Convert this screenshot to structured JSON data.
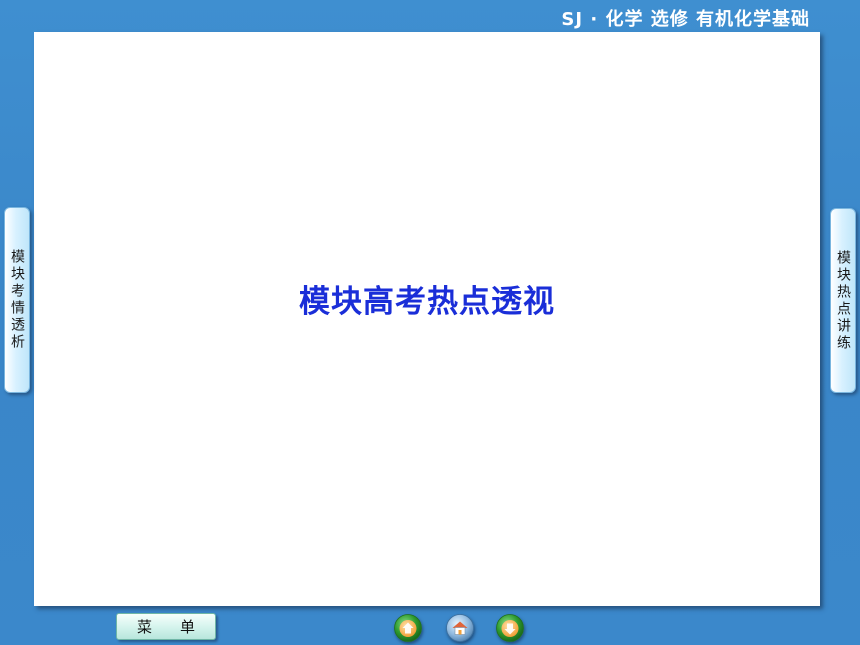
{
  "header": {
    "title": "SJ · 化学  选修  有机化学基础"
  },
  "slide": {
    "heading": "模块高考热点透视"
  },
  "side_tabs": {
    "left_label": "模块考情透析",
    "right_label": "模块热点讲练"
  },
  "bottom_bar": {
    "menu_label": "菜单",
    "nav_icons": [
      "prev-arrow-icon",
      "home-icon",
      "next-arrow-icon"
    ]
  },
  "colors": {
    "background": "#3b88cb",
    "heading": "#1a2ed8",
    "nav_green": "#2e9b2e",
    "nav_orange": "#f2a23a"
  }
}
